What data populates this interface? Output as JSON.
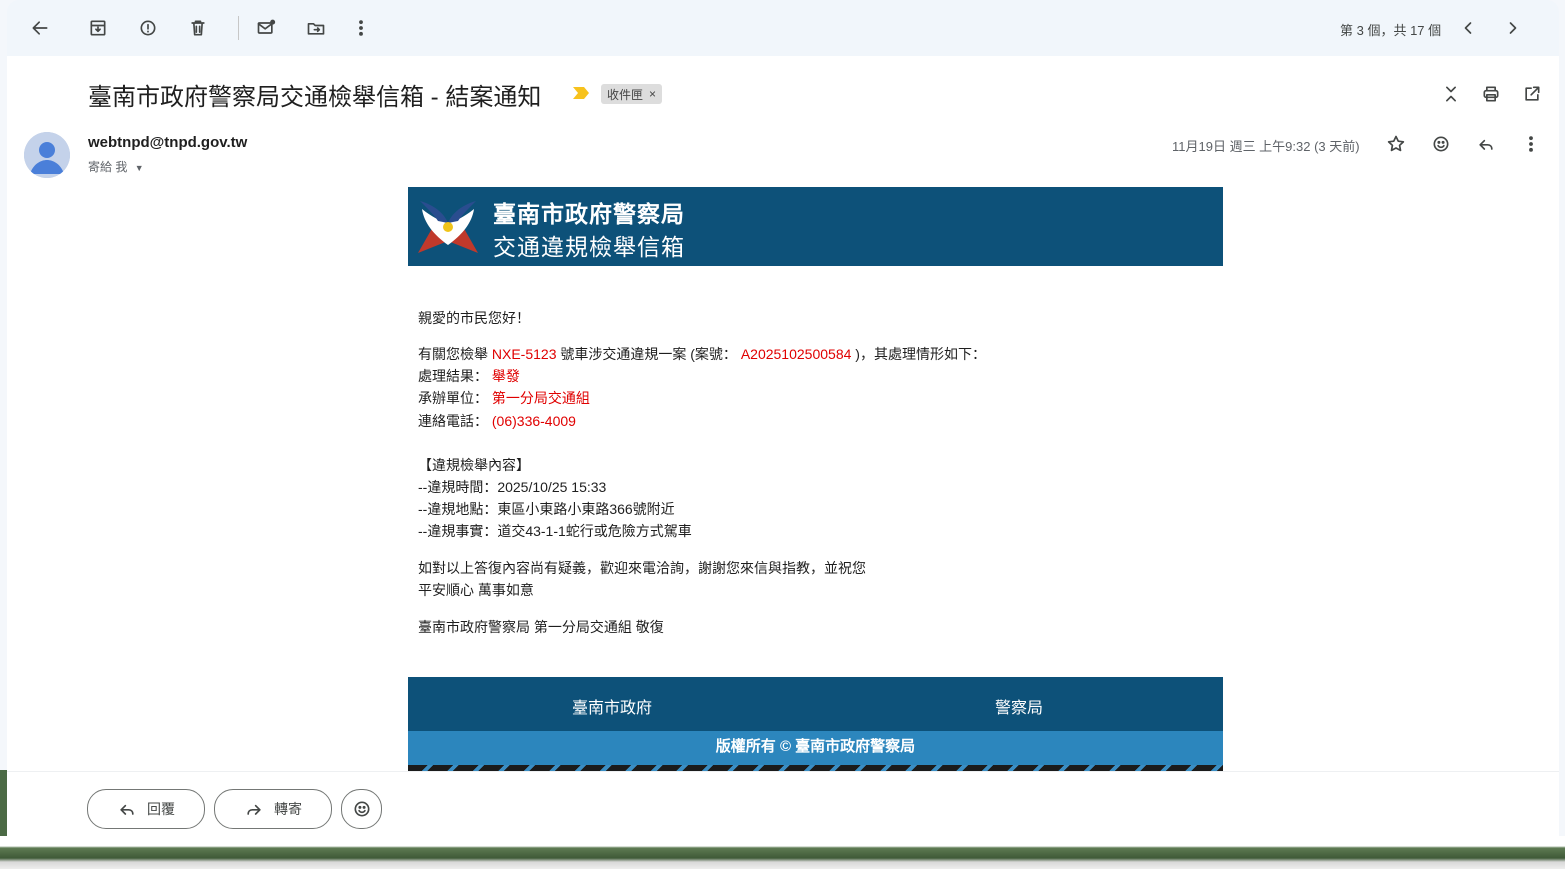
{
  "toolbar": {
    "back": "back-arrow-icon",
    "archive": "archive-icon",
    "report_spam": "report-spam-icon",
    "delete": "trash-icon",
    "mark_unread": "mark-unread-icon",
    "move_to": "move-to-icon",
    "more": "more-vert-icon",
    "pager_text": "第 3 個，共 17 個",
    "prev": "chevron-left-icon",
    "next": "chevron-right-icon"
  },
  "message": {
    "subject": "臺南市政府警察局交通檢舉信箱 - 結案通知",
    "label": "收件匣",
    "label_remove": "×",
    "sender": "webtnpd@tnpd.gov.tw",
    "recipient": "寄給 我",
    "date": "11月19日 週三 上午9:32 (3 天前)"
  },
  "email": {
    "header_title1": "臺南市政府警察局",
    "header_title2": "交通違規檢舉信箱",
    "greeting": "親愛的市民您好！",
    "intro_a": "有關您檢舉 ",
    "plate": "NXE-5123",
    "intro_b": " 號車涉交通違規一案 (案號： ",
    "case_no": "A2025102500584",
    "intro_c": " )，其處理情形如下：",
    "result_label": "處理結果： ",
    "result_value": "舉發",
    "unit_label": "承辦單位： ",
    "unit_value": "第一分局交通組",
    "phone_label": "連絡電話： ",
    "phone_value": "(06)336-4009",
    "section_title": "【違規檢舉內容】",
    "time_line": "--違規時間：2025/10/25 15:33",
    "place_line": "--違規地點：東區小東路小東路366號附近",
    "fact_line": "--違規事實：道交43-1-1蛇行或危險方式駕車",
    "closing1": "如對以上答復內容尚有疑義，歡迎來電洽詢，謝謝您來信與指教，並祝您",
    "closing2": "平安順心 萬事如意",
    "signature": "臺南市政府警察局 第一分局交通組 敬復",
    "footer_link1": "臺南市政府",
    "footer_link2": "警察局",
    "copyright": "版權所有 © 臺南市政府警察局"
  },
  "actions": {
    "reply": "回覆",
    "forward": "轉寄"
  },
  "colors": {
    "header_bg": "#0d5179",
    "footer_bar": "#2c86bd",
    "highlight_red": "#e00000"
  }
}
